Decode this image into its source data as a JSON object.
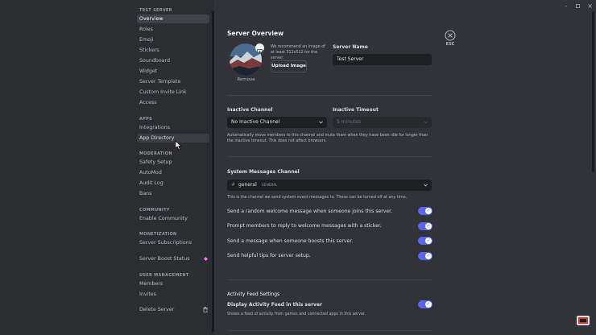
{
  "sidebar": {
    "server_section": "TEST SERVER",
    "server_items": [
      "Overview",
      "Roles",
      "Emoji",
      "Stickers",
      "Soundboard",
      "Widget",
      "Server Template",
      "Custom Invite Link",
      "Access"
    ],
    "apps_section": "APPS",
    "apps_items": [
      "Integrations",
      "App Directory"
    ],
    "moderation_section": "MODERATION",
    "moderation_items": [
      "Safety Setup",
      "AutoMod",
      "Audit Log",
      "Bans"
    ],
    "community_section": "COMMUNITY",
    "community_items": [
      "Enable Community"
    ],
    "monetization_section": "MONETIZATION",
    "monetization_items": [
      "Server Subscriptions"
    ],
    "boost_label": "Server Boost Status",
    "user_mgmt_section": "USER MANAGEMENT",
    "user_mgmt_items": [
      "Members",
      "Invites"
    ],
    "delete_label": "Delete Server"
  },
  "main": {
    "title": "Server Overview",
    "esc_label": "ESC",
    "image_hint": "We recommend an image of at least 512x512 for the server.",
    "upload_button": "Upload Image",
    "remove_link": "Remove",
    "server_name_label": "Server Name",
    "server_name_value": "Test Server",
    "inactive_channel_label": "Inactive Channel",
    "inactive_channel_value": "No Inactive Channel",
    "inactive_timeout_label": "Inactive Timeout",
    "inactive_timeout_value": "5 minutes",
    "inactive_help": "Automatically move members to this channel and mute them when they have been idle for longer than the inactive timeout. This does not affect browsers.",
    "system_channel_label": "System Messages Channel",
    "system_channel_hash": "#",
    "system_channel_name": "general",
    "system_channel_category": "GENERAL",
    "system_channel_help": "This is the channel we send system event messages to. These can be turned off at any time.",
    "toggles": [
      "Send a random welcome message when someone joins this server.",
      "Prompt members to reply to welcome messages with a sticker.",
      "Send a message when someone boosts this server.",
      "Send helpful tips for server setup."
    ],
    "activity_section": "Activity Feed Settings",
    "activity_toggle": "Display Activity Feed in this server",
    "activity_help": "Shows a feed of activity from games and connected apps in this server."
  },
  "colors": {
    "accent": "#5865f2",
    "boost": "#ff73fa"
  }
}
